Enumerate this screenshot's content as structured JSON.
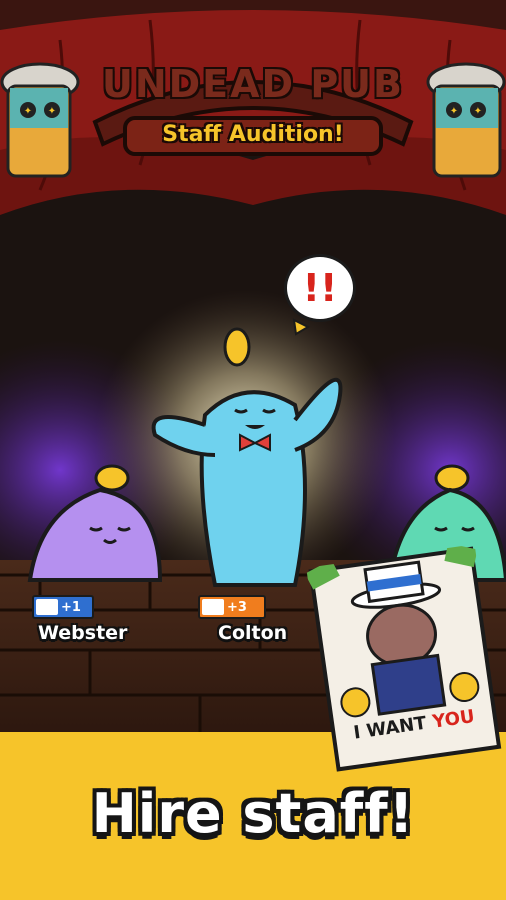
{
  "sign": {
    "title": "UNDEAD PUB",
    "subtitle": "Staff Audition!"
  },
  "alert": {
    "text": "!!"
  },
  "candidates": [
    {
      "name": "Webster",
      "badge": "+1",
      "badge_color": "#2f6fd0",
      "color": "#b590ef"
    },
    {
      "name": "Colton",
      "badge": "+3",
      "badge_color": "#f07d1e",
      "color": "#6fd2ee"
    }
  ],
  "poster": {
    "text_1": "I WANT",
    "text_2": "YOU"
  },
  "cta": {
    "text": "Hire staff!"
  },
  "colors": {
    "banner": "#f6c42a",
    "curtain": "#8a1a16",
    "stage_glow": "#5b2bb0"
  }
}
